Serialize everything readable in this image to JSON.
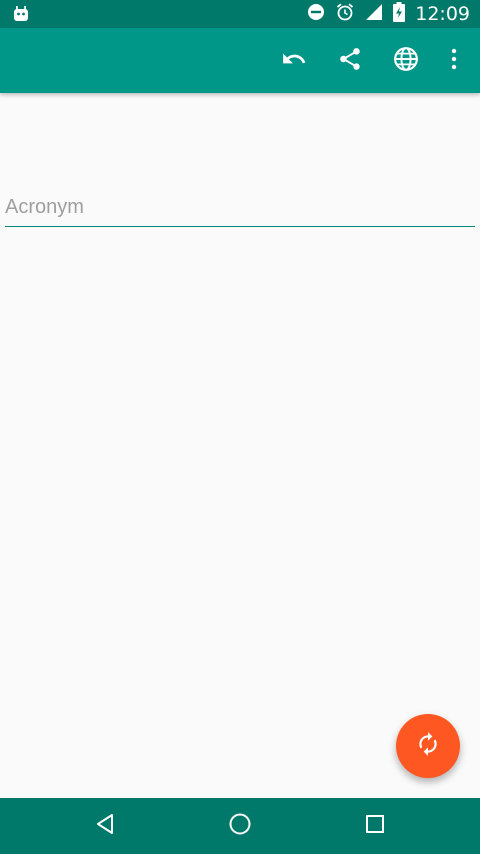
{
  "status_bar": {
    "time": "12:09",
    "icons": [
      "android-icon",
      "do-not-disturb-icon",
      "alarm-icon",
      "signal-icon",
      "battery-charging-icon"
    ]
  },
  "toolbar": {
    "actions": [
      "undo-icon",
      "share-icon",
      "globe-icon",
      "more-vert-icon"
    ]
  },
  "form": {
    "acronym_placeholder": "Acronym",
    "acronym_value": ""
  },
  "fab": {
    "icon": "refresh-icon",
    "color": "#ff5722"
  },
  "navigation": {
    "buttons": [
      "back-icon",
      "home-icon",
      "recents-icon"
    ]
  },
  "colors": {
    "primary": "#009688",
    "primary_dark": "#00796b",
    "accent": "#ff5722",
    "background": "#fafafa"
  }
}
